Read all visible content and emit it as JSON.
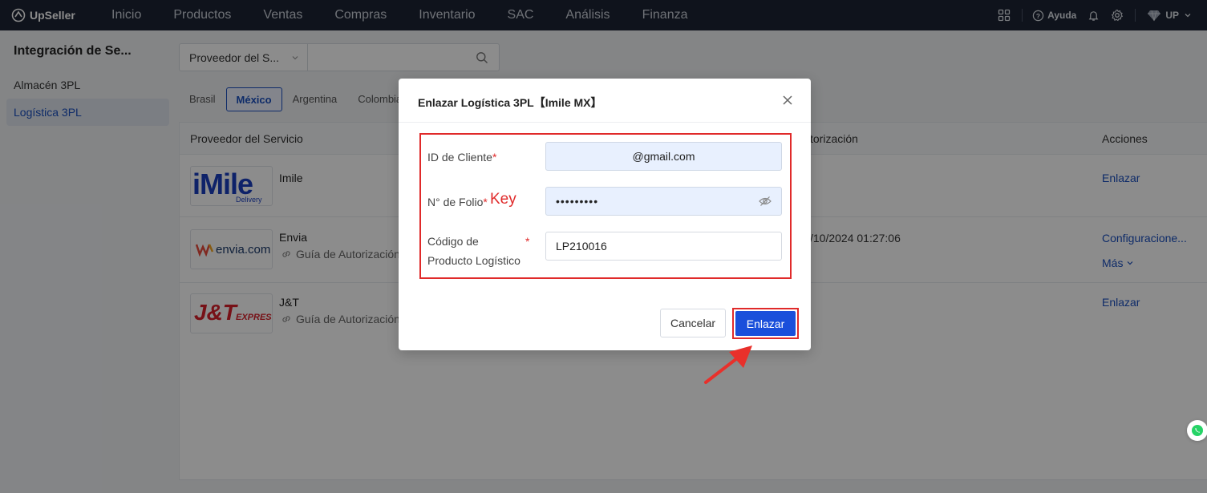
{
  "app": {
    "brand": "UpSeller"
  },
  "nav": {
    "items": [
      "Inicio",
      "Productos",
      "Ventas",
      "Compras",
      "Inventario",
      "SAC",
      "Análisis",
      "Finanza"
    ],
    "help": "Ayuda",
    "user": "UP"
  },
  "sidebar": {
    "title": "Integración de Se...",
    "items": [
      {
        "label": "Almacén 3PL",
        "active": false
      },
      {
        "label": "Logística 3PL",
        "active": true
      }
    ]
  },
  "search": {
    "select_value": "Proveedor del S...",
    "placeholder": ""
  },
  "tabs": [
    {
      "label": "Brasil",
      "active": false
    },
    {
      "label": "México",
      "active": true
    },
    {
      "label": "Argentina",
      "active": false
    },
    {
      "label": "Colombia",
      "active": false
    }
  ],
  "table": {
    "headers": {
      "provider": "Proveedor del Servicio",
      "auth": "torización",
      "actions": "Acciones"
    },
    "rows": [
      {
        "name": "Imile",
        "logo": "iMile",
        "logo_sub": "Delivery",
        "guide": "",
        "auth_time": "",
        "action": "Enlazar",
        "more": ""
      },
      {
        "name": "Envia",
        "logo": "envia.com",
        "logo_sub": "",
        "guide": "Guía de Autorización",
        "auth_time": "/10/2024 01:27:06",
        "action": "Configuracione...",
        "more": "Más"
      },
      {
        "name": "J&T",
        "logo": "J&T",
        "logo_sub": "EXPRESS",
        "guide": "Guía de Autorización",
        "auth_time": "",
        "action": "Enlazar",
        "more": ""
      }
    ]
  },
  "modal": {
    "title": "Enlazar Logística 3PL【Imile MX】",
    "fields": [
      {
        "label": "ID de Cliente",
        "required_mark": "*",
        "value": "@gmail.com"
      },
      {
        "label": "N° de Folio",
        "required_mark": "*",
        "value": "•••••••••",
        "note": "Key"
      },
      {
        "label_line1": "Código de",
        "label_line2": "Producto Logístico",
        "required_mark": "*",
        "value": "LP210016"
      }
    ],
    "cancel_label": "Cancelar",
    "confirm_label": "Enlazar"
  },
  "colors": {
    "nav_bg": "#1d2434",
    "accent": "#1a4fbf",
    "primary_button": "#1a4fdb",
    "annotation": "#e02a2a"
  }
}
